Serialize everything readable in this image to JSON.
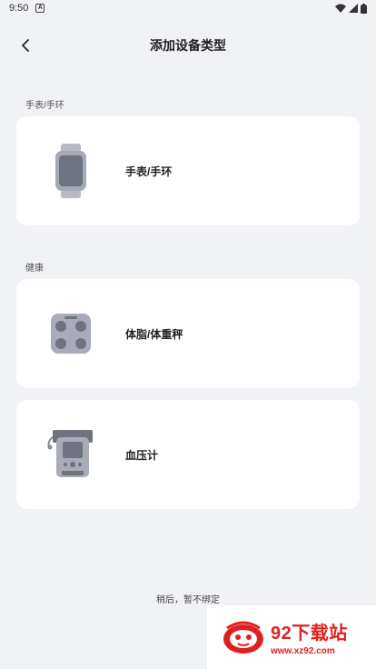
{
  "status": {
    "time": "9:50",
    "notification_icon": "A"
  },
  "header": {
    "title": "添加设备类型",
    "back_icon": "chevron-left-icon"
  },
  "sections": [
    {
      "label": "手表/手环"
    },
    {
      "label": "健康"
    }
  ],
  "cards": [
    {
      "label": "手表/手环",
      "icon": "smartwatch-icon"
    },
    {
      "label": "体脂/体重秤",
      "icon": "body-fat-scale-icon"
    },
    {
      "label": "血压计",
      "icon": "blood-pressure-monitor-icon"
    }
  ],
  "footer": {
    "skip_label": "稍后，暂不绑定"
  },
  "watermark": {
    "brand": "92下载站",
    "url": "www.xz92.com"
  },
  "colors": {
    "background": "#f1f2f6",
    "card": "#ffffff",
    "device_gray": "#a9acb8",
    "watermark_red": "#e02020"
  }
}
